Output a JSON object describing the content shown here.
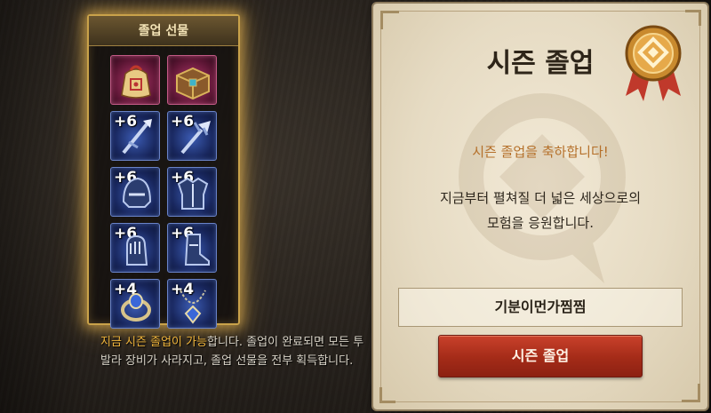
{
  "reward_panel": {
    "title": "졸업 선물",
    "items": [
      {
        "name": "gift-bag",
        "plus": ""
      },
      {
        "name": "treasure-chest",
        "plus": ""
      },
      {
        "name": "spear-weapon",
        "plus": "+6"
      },
      {
        "name": "trident-weapon",
        "plus": "+6"
      },
      {
        "name": "helmet-armor",
        "plus": "+6"
      },
      {
        "name": "chest-armor",
        "plus": "+6"
      },
      {
        "name": "gauntlet-armor",
        "plus": "+6"
      },
      {
        "name": "boot-armor",
        "plus": "+6"
      },
      {
        "name": "ring-accessory",
        "plus": "+4"
      },
      {
        "name": "necklace-accessory",
        "plus": "+4"
      }
    ]
  },
  "description": {
    "highlight": "지금 시즌 졸업이 가능",
    "rest": "합니다. 졸업이 완료되면 모든 투발라 장비가 사라지고, 졸업 선물을 전부 획득합니다."
  },
  "card": {
    "title": "시즌 졸업",
    "congrats": "시즌 졸업을 축하합니다!",
    "message_line1": "지금부터 펼쳐질 더 넓은 세상으로의",
    "message_line2": "모험을 응원합니다.",
    "character_name": "기분이먼가찜찜",
    "button_label": "시즌 졸업"
  },
  "colors": {
    "accent_gold": "#f0b53c",
    "button_red": "#a42b18",
    "parchment": "#e6dbc3",
    "congrats_text": "#b5702a"
  }
}
